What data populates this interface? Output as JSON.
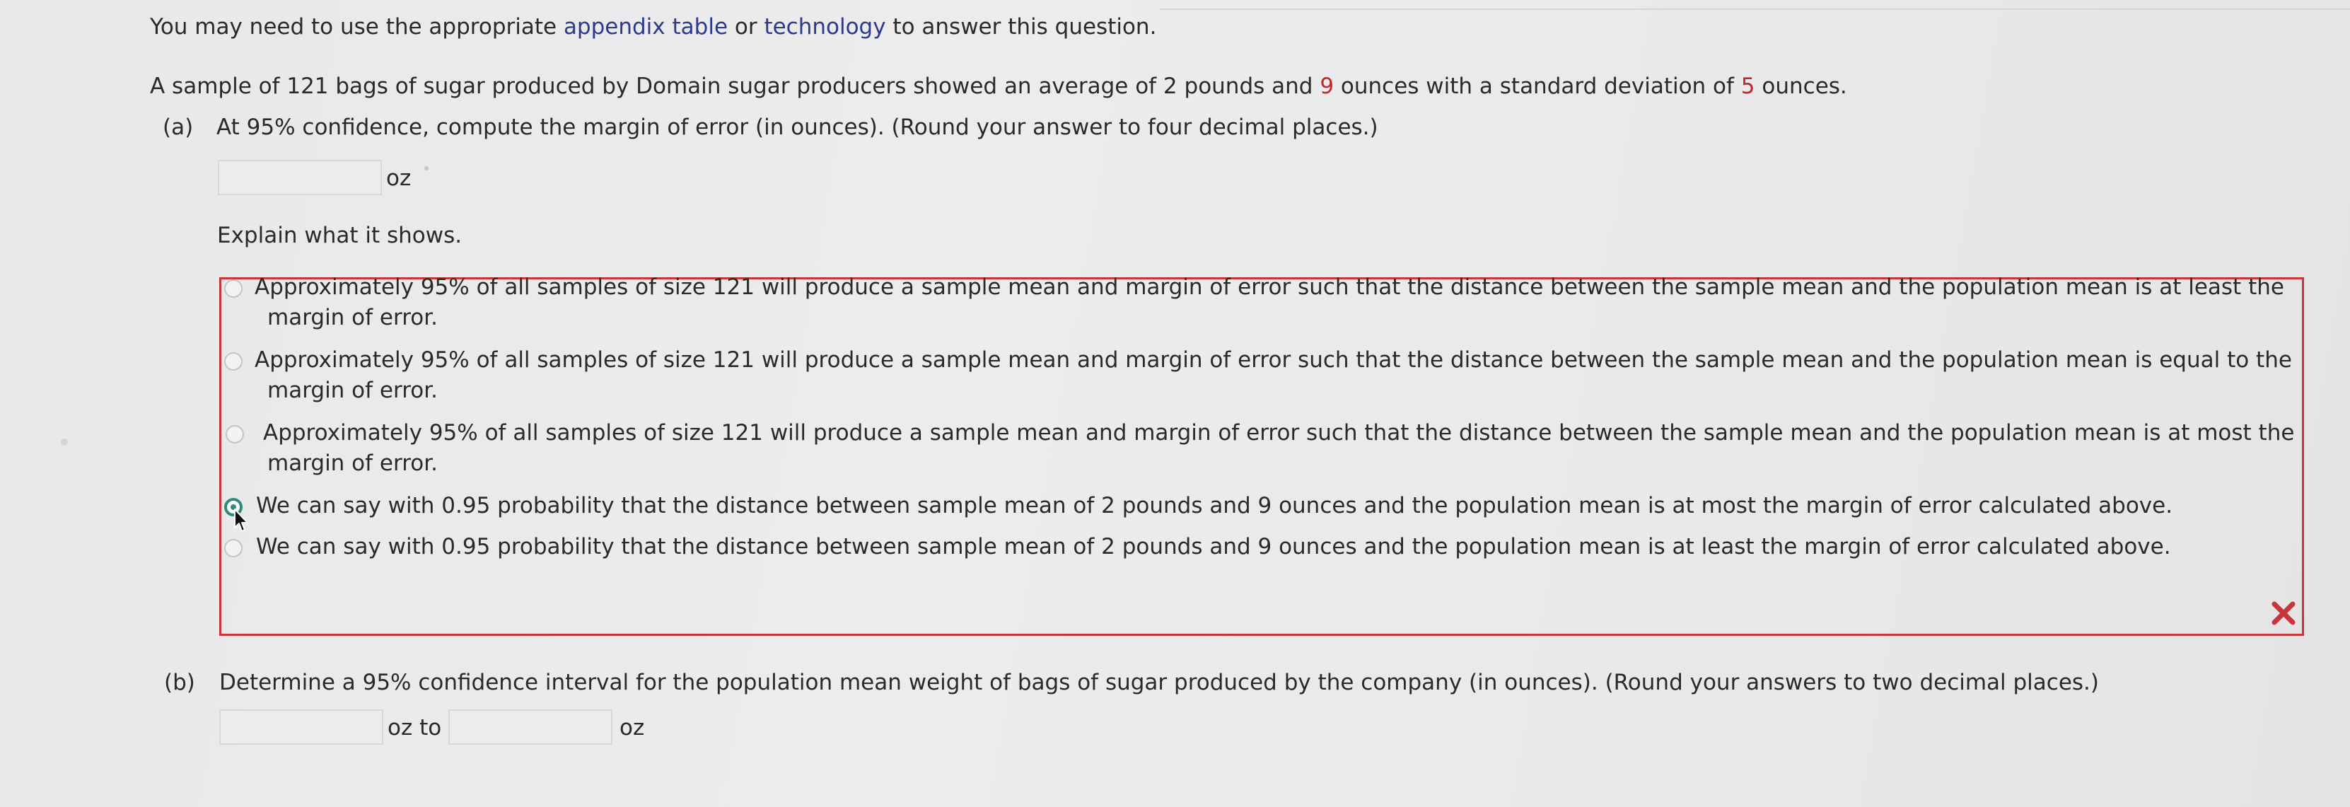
{
  "intro": {
    "prefix": "You may need to use the appropriate ",
    "link1": "appendix table",
    "middle": " or ",
    "link2": "technology",
    "suffix": " to answer this question."
  },
  "problem": {
    "part1": "A sample of 121 bags of sugar produced by Domain sugar producers showed an average of 2 pounds and ",
    "ounces_highlight": "9",
    "part2": " ounces with a standard deviation of ",
    "sd_highlight": "5",
    "part3": " ounces."
  },
  "part_a": {
    "label": "(a)",
    "question": "At 95% confidence, compute the margin of error (in ounces). (Round your answer to four decimal places.)",
    "answer_value": "",
    "unit": "oz",
    "explain_prompt": "Explain what it shows.",
    "options": [
      {
        "line1": "Approximately 95% of all samples of size 121 will produce a sample mean and margin of error such that the distance between the sample mean and the population mean is at least the",
        "line2": "margin of error."
      },
      {
        "line1": "Approximately 95% of all samples of size 121 will produce a sample mean and margin of error such that the distance between the sample mean and the population mean is equal to the",
        "line2": "margin of error."
      },
      {
        "line1": "Approximately 95% of all samples of size 121 will produce a sample mean and margin of error such that the distance between the sample mean and the population mean is at most the",
        "line2": "margin of error."
      },
      {
        "line1": "We can say with 0.95 probability that the distance between sample mean of 2 pounds and 9 ounces and the population mean is at most the margin of error calculated above.",
        "line2": ""
      },
      {
        "line1": "We can say with 0.95 probability that the distance between sample mean of 2 pounds and 9 ounces and the population mean is at least the margin of error calculated above.",
        "line2": ""
      }
    ],
    "selected_option_index": 3,
    "status": "incorrect",
    "status_color": "#c9353b"
  },
  "part_b": {
    "label": "(b)",
    "question": "Determine a 95% confidence interval for the population mean weight of bags of sugar produced by the company (in ounces). (Round your answers to two decimal places.)",
    "lower_value": "",
    "upper_value": "",
    "unit_to": "oz to",
    "unit_end": "oz"
  },
  "colors": {
    "link": "#2d3a8c",
    "highlight": "#c0282d",
    "selected_radio": "#2f8a7c",
    "error_border": "#c9353b"
  }
}
